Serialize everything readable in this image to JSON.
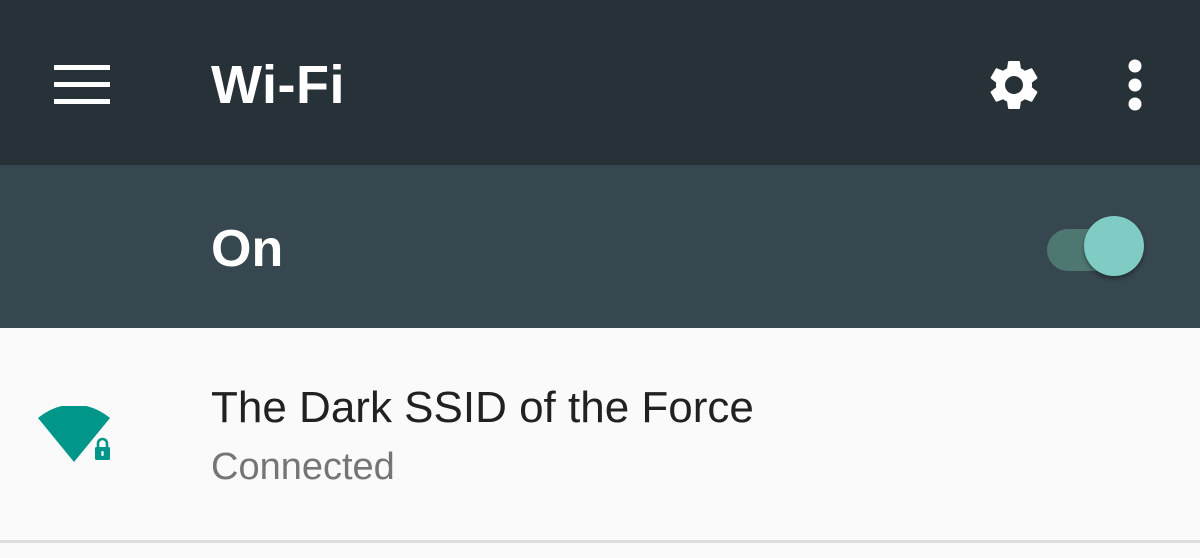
{
  "toolbar": {
    "title": "Wi-Fi",
    "menu_icon": "hamburger-menu-icon",
    "settings_icon": "gear-icon",
    "overflow_icon": "more-vert-icon",
    "background": "#263238"
  },
  "master_switch": {
    "label": "On",
    "state": "on",
    "background": "#37474f",
    "thumb_color": "#80cbc4"
  },
  "networks": [
    {
      "ssid": "The Dark SSID of the Force",
      "status": "Connected",
      "icon": "wifi-signal-secured-icon",
      "secured": true,
      "accent_color": "#00968a"
    }
  ]
}
